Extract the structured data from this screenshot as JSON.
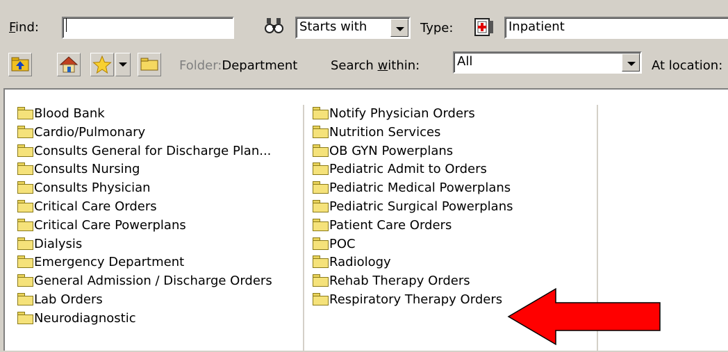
{
  "toolbar": {
    "find_label": "Find:",
    "find_value": "",
    "match_value": "Starts with",
    "type_label": "Type:",
    "type_value": "Inpatient",
    "folder_label": "Folder:",
    "folder_value": "Department",
    "search_within_label": "Search within:",
    "search_within_value": "All",
    "at_location_label": "At location:"
  },
  "folders": {
    "column1": [
      "Blood Bank",
      "Cardio/Pulmonary",
      "Consults General for Discharge Plan...",
      "Consults Nursing",
      "Consults Physician",
      "Critical Care Orders",
      "Critical Care Powerplans",
      "Dialysis",
      "Emergency Department",
      "General Admission / Discharge Orders",
      "Lab Orders",
      "Neurodiagnostic"
    ],
    "column2": [
      "Notify Physician Orders",
      "Nutrition Services",
      "OB GYN Powerplans",
      "Pediatric Admit to Orders",
      "Pediatric Medical Powerplans",
      "Pediatric Surgical Powerplans",
      "Patient Care Orders",
      "POC",
      "Radiology",
      "Rehab Therapy Orders",
      "Respiratory Therapy Orders"
    ]
  },
  "annotation": {
    "arrow_color": "#ff0000"
  },
  "icons": {
    "binoculars": "binoculars-icon",
    "type": "inpatient-icon",
    "up": "folder-up-icon",
    "home": "home-icon",
    "favorites": "star-icon",
    "folder": "folder-icon"
  }
}
